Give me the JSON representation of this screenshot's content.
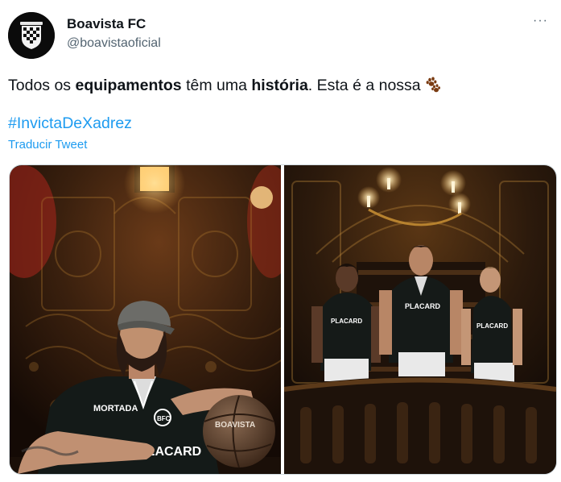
{
  "account": {
    "name": "Boavista FC",
    "handle": "@boavistaoficial",
    "more_label": "···"
  },
  "tweet": {
    "part1": "Todos os ",
    "bold1": "equipamentos",
    "part2": " têm uma ",
    "bold2": "história",
    "part3": ". Esta é a nossa",
    "emoji": "paw-prints-icon",
    "hashtag": "#InvictaDeXadrez",
    "translate": "Traducir Tweet"
  },
  "media": {
    "photo1": {
      "ball_text": "BOAVISTA",
      "shirt_sponsor": "PLACARD"
    },
    "photo2": {
      "shirt_sponsor": "PLACARD"
    }
  },
  "colors": {
    "link": "#1d9bf0",
    "secondary_text": "#536471",
    "primary_text": "#0f1419"
  }
}
